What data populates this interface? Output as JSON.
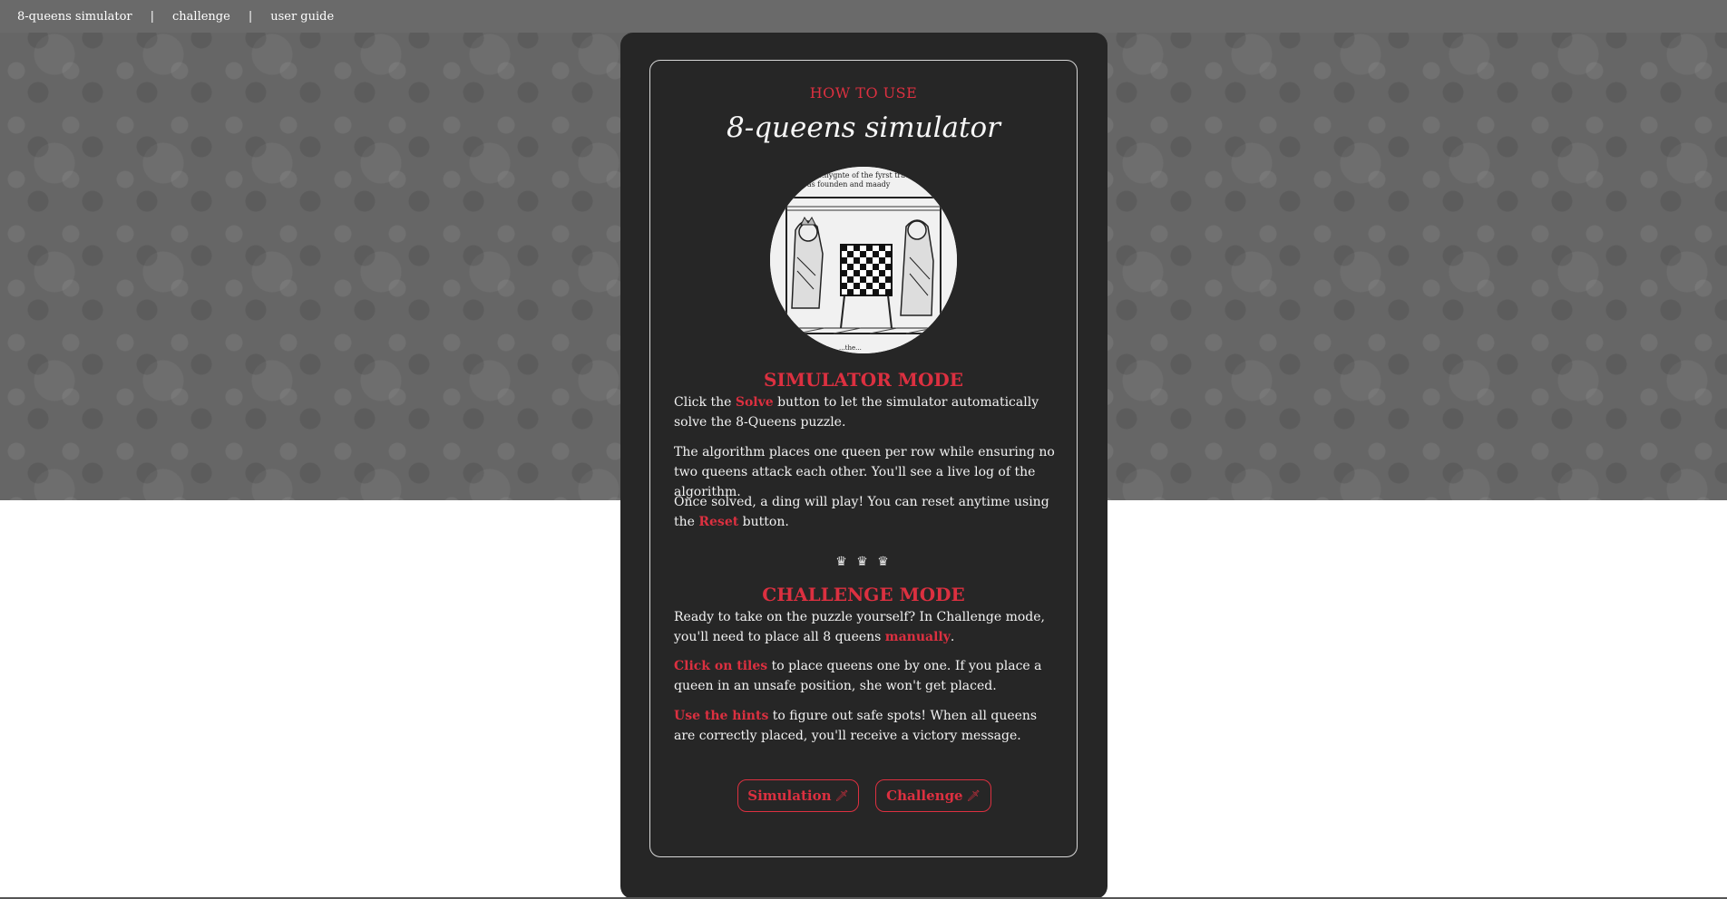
{
  "nav": {
    "items": [
      "8-queens simulator",
      "challenge",
      "user guide"
    ],
    "separator": "|"
  },
  "card": {
    "eyebrow": "HOW TO USE",
    "title": "8-queens simulator",
    "illustration": {
      "caption_top_line1": "...nygnte of the fyrst tractat",
      "caption_top_line2": "was founden and maady",
      "caption_bottom": "...the..."
    },
    "simulator": {
      "heading": "SIMULATOR MODE",
      "p1_before": "Click the ",
      "p1_highlight": "Solve",
      "p1_after": " button to let the simulator automatically solve the 8-Queens puzzle.",
      "p2": "The algorithm places one queen per row while ensuring no two queens attack each other. You'll see a live log of the algorithm.",
      "p3_before": "Once solved, a ding will play! You can reset anytime using the ",
      "p3_highlight": "Reset",
      "p3_after": " button."
    },
    "divider": "♛ ♛ ♛",
    "challenge": {
      "heading": "CHALLENGE MODE",
      "p1_before": "Ready to take on the puzzle yourself? In Challenge mode, you'll need to place all 8 queens ",
      "p1_highlight": "manually",
      "p1_after": ".",
      "p2_highlight": "Click on tiles",
      "p2_after": " to place queens one by one. If you place a queen in an unsafe position, she won't get placed.",
      "p3_highlight": "Use the hints",
      "p3_after": " to figure out safe spots! When all queens are correctly placed, you'll receive a victory message."
    },
    "buttons": {
      "simulation_label": "Simulation",
      "challenge_label": "Challenge",
      "icon": "sword-icon"
    }
  },
  "colors": {
    "accent": "#dc3040",
    "card_bg": "#262626",
    "nav_bg": "#6a6a6a"
  }
}
